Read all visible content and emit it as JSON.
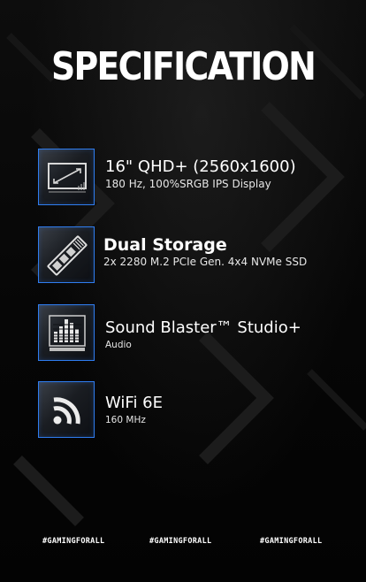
{
  "title": "SPECIFICATION",
  "specs": [
    {
      "icon": "display-icon",
      "title": "16\" QHD+ (2560x1600)",
      "subtitle": "180 Hz, 100%SRGB IPS Display"
    },
    {
      "icon": "ssd-icon",
      "title": "Dual Storage",
      "subtitle": "2x 2280 M.2 PCIe Gen. 4x4 NVMe SSD"
    },
    {
      "icon": "sound-icon",
      "title": "Sound Blaster™ Studio+",
      "subtitle": "Audio"
    },
    {
      "icon": "wifi-icon",
      "title": "WiFi 6E",
      "subtitle": "160 MHz"
    }
  ],
  "footer": {
    "hashtags": [
      "#GAMINGFORALL",
      "#GAMINGFORALL",
      "#GAMINGFORALL"
    ]
  },
  "colors": {
    "accent": "#2f7df0",
    "background": "#070707",
    "text": "#ffffff"
  }
}
